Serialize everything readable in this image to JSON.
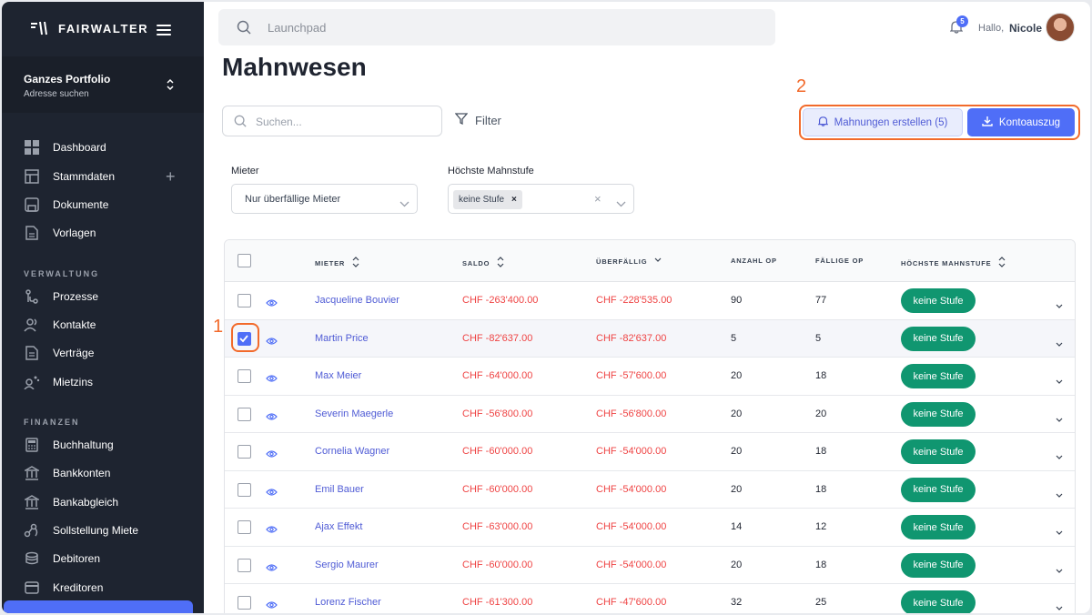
{
  "brand": "FAIRWALTER",
  "portfolio": {
    "name": "Ganzes Portfolio",
    "sub": "Adresse suchen"
  },
  "nav": {
    "main": [
      "Dashboard",
      "Stammdaten",
      "Dokumente",
      "Vorlagen"
    ],
    "section1": "VERWALTUNG",
    "verwaltung": [
      "Prozesse",
      "Kontakte",
      "Verträge",
      "Mietzins"
    ],
    "section2": "FINANZEN",
    "finanzen": [
      "Buchhaltung",
      "Bankkonten",
      "Bankabgleich",
      "Sollstellung Miete",
      "Debitoren",
      "Kreditoren"
    ]
  },
  "topbar": {
    "search_placeholder": "Launchpad",
    "badge": "5",
    "hello": "Hallo,",
    "user": "Nicole"
  },
  "page": {
    "title": "Mahnwesen",
    "search_placeholder": "Suchen...",
    "filter": "Filter"
  },
  "annotations": {
    "a1": "1",
    "a2": "2"
  },
  "buttons": {
    "mahnungen": "Mahnungen erstellen (5)",
    "konto": "Kontoauszug"
  },
  "filters": {
    "mieter_label": "Mieter",
    "mieter_value": "Nur überfällige Mieter",
    "stufe_label": "Höchste Mahnstufe",
    "stufe_tag": "keine Stufe",
    "tag_remove": "×",
    "clear": "×"
  },
  "table": {
    "headers": [
      "MIETER",
      "SALDO",
      "ÜBERFÄLLIG",
      "ANZAHL OP",
      "FÄLLIGE OP",
      "HÖCHSTE MAHNSTUFE"
    ],
    "rows": [
      {
        "name": "Jacqueline Bouvier",
        "saldo": "CHF -263'400.00",
        "ueberfaellig": "CHF -228'535.00",
        "anzahl": "90",
        "faellig": "77",
        "stufe": "keine Stufe",
        "checked": false
      },
      {
        "name": "Martin Price",
        "saldo": "CHF -82'637.00",
        "ueberfaellig": "CHF -82'637.00",
        "anzahl": "5",
        "faellig": "5",
        "stufe": "keine Stufe",
        "checked": true
      },
      {
        "name": "Max Meier",
        "saldo": "CHF -64'000.00",
        "ueberfaellig": "CHF -57'600.00",
        "anzahl": "20",
        "faellig": "18",
        "stufe": "keine Stufe",
        "checked": false
      },
      {
        "name": "Severin Maegerle",
        "saldo": "CHF -56'800.00",
        "ueberfaellig": "CHF -56'800.00",
        "anzahl": "20",
        "faellig": "20",
        "stufe": "keine Stufe",
        "checked": false
      },
      {
        "name": "Cornelia Wagner",
        "saldo": "CHF -60'000.00",
        "ueberfaellig": "CHF -54'000.00",
        "anzahl": "20",
        "faellig": "18",
        "stufe": "keine Stufe",
        "checked": false
      },
      {
        "name": "Emil Bauer",
        "saldo": "CHF -60'000.00",
        "ueberfaellig": "CHF -54'000.00",
        "anzahl": "20",
        "faellig": "18",
        "stufe": "keine Stufe",
        "checked": false
      },
      {
        "name": "Ajax Effekt",
        "saldo": "CHF -63'000.00",
        "ueberfaellig": "CHF -54'000.00",
        "anzahl": "14",
        "faellig": "12",
        "stufe": "keine Stufe",
        "checked": false
      },
      {
        "name": "Sergio Maurer",
        "saldo": "CHF -60'000.00",
        "ueberfaellig": "CHF -54'000.00",
        "anzahl": "20",
        "faellig": "18",
        "stufe": "keine Stufe",
        "checked": false
      },
      {
        "name": "Lorenz Fischer",
        "saldo": "CHF -61'300.00",
        "ueberfaellig": "CHF -47'600.00",
        "anzahl": "32",
        "faellig": "25",
        "stufe": "keine Stufe",
        "checked": false
      }
    ]
  },
  "colors": {
    "accent": "#4f6ef7",
    "danger": "#ef4444",
    "badge_green": "#109670",
    "highlight": "#f26a2b"
  }
}
